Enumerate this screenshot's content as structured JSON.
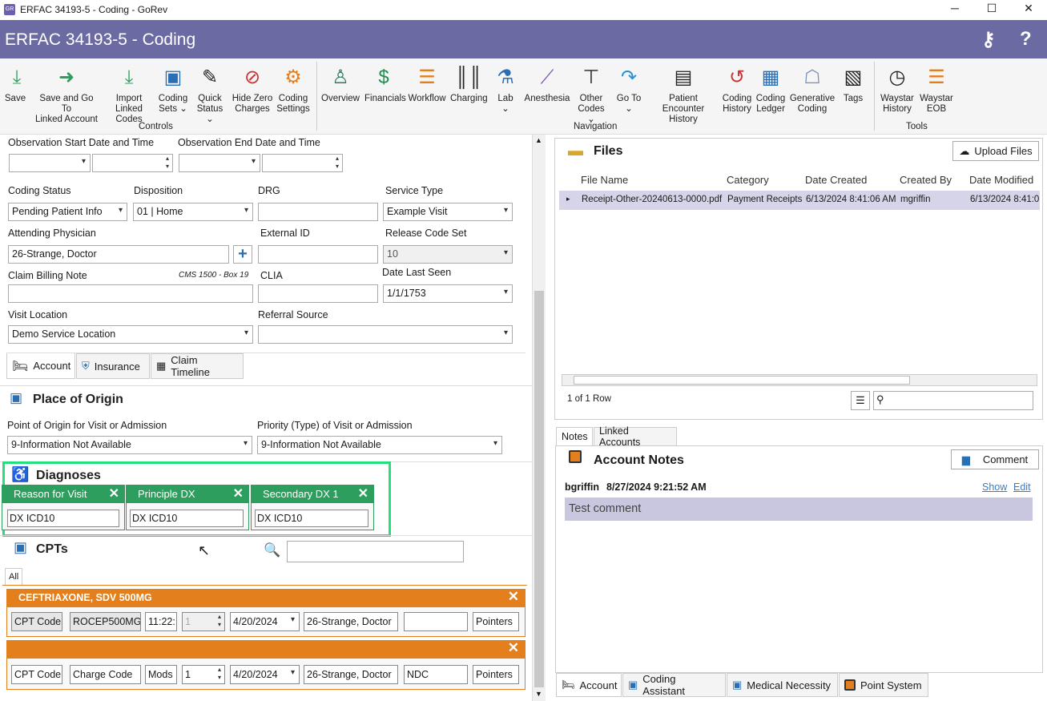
{
  "window": {
    "title": "ERFAC 34193-5 - Coding - GoRev",
    "app_icon": "GR"
  },
  "header": {
    "title": "ERFAC 34193-5 - Coding"
  },
  "ribbon": {
    "controls": [
      {
        "name": "save",
        "label": "Save"
      },
      {
        "name": "save-go-linked",
        "label": "Save and Go To\nLinked Account"
      },
      {
        "name": "import-linked",
        "label": "Import\nLinked Codes"
      },
      {
        "name": "coding-sets",
        "label": "Coding\nSets ⌄"
      },
      {
        "name": "quick-status",
        "label": "Quick\nStatus ⌄"
      },
      {
        "name": "hide-zero",
        "label": "Hide Zero\nCharges"
      },
      {
        "name": "coding-settings",
        "label": "Coding\nSettings"
      }
    ],
    "navigation": [
      {
        "name": "overview",
        "label": "Overview"
      },
      {
        "name": "financials",
        "label": "Financials"
      },
      {
        "name": "workflow",
        "label": "Workflow"
      },
      {
        "name": "charging",
        "label": "Charging"
      },
      {
        "name": "lab",
        "label": "Lab\n⌄"
      },
      {
        "name": "anesthesia",
        "label": "Anesthesia"
      },
      {
        "name": "other-codes",
        "label": "Other\nCodes ⌄"
      },
      {
        "name": "go-to",
        "label": "Go To\n⌄"
      },
      {
        "name": "encounter-history",
        "label": "Patient Encounter\nHistory"
      },
      {
        "name": "coding-history",
        "label": "Coding\nHistory"
      },
      {
        "name": "coding-ledger",
        "label": "Coding\nLedger"
      },
      {
        "name": "generative-coding",
        "label": "Generative\nCoding"
      },
      {
        "name": "tags",
        "label": "Tags"
      }
    ],
    "tools": [
      {
        "name": "waystar-history",
        "label": "Waystar\nHistory"
      },
      {
        "name": "waystar-eob",
        "label": "Waystar\nEOB"
      }
    ],
    "groups": {
      "controls": "Controls",
      "navigation": "Navigation",
      "tools": "Tools"
    }
  },
  "form": {
    "obs_start_label": "Observation Start Date and Time",
    "obs_end_label": "Observation End Date and Time",
    "coding_status_label": "Coding Status",
    "coding_status": "Pending Patient Info",
    "disposition_label": "Disposition",
    "disposition": "01 | Home",
    "drg_label": "DRG",
    "service_type_label": "Service Type",
    "service_type": "Example Visit",
    "attending_label": "Attending Physician",
    "attending": "26-Strange, Doctor",
    "external_id_label": "External ID",
    "release_code_label": "Release Code Set",
    "release_code": "10",
    "claim_note_label": "Claim Billing Note",
    "claim_note_hint": "CMS 1500 - Box 19",
    "clia_label": "CLIA",
    "last_seen_label": "Date Last Seen",
    "last_seen": "1/1/1753",
    "visit_location_label": "Visit Location",
    "visit_location": "Demo Service Location",
    "referral_label": "Referral Source"
  },
  "form_tabs": [
    "Account",
    "Insurance",
    "Claim Timeline"
  ],
  "origin": {
    "title": "Place of Origin",
    "point_label": "Point of Origin for Visit or Admission",
    "point": "9-Information Not Available",
    "priority_label": "Priority (Type) of Visit or Admission",
    "priority": "9-Information Not Available"
  },
  "diagnoses": {
    "title": "Diagnoses",
    "cards": [
      {
        "title": "Reason for Visit",
        "value": "DX ICD10"
      },
      {
        "title": "Principle DX",
        "value": "DX ICD10"
      },
      {
        "title": "Secondary DX 1",
        "value": "DX ICD10"
      }
    ]
  },
  "cpts": {
    "title": "CPTs",
    "filter_tab": "All",
    "items": [
      {
        "title": "CEFTRIAXONE, SDV 500MG",
        "code": "CPT Code",
        "charge": "ROCEP500MG",
        "mods": "11:22:",
        "qty": "1",
        "date": "4/20/2024",
        "provider": "26-Strange, Doctor",
        "ndc": "",
        "pointers": "Pointers"
      },
      {
        "title": "",
        "code": "CPT Code",
        "charge": "Charge Code",
        "mods": "Mods",
        "qty": "1",
        "date": "4/20/2024",
        "provider": "26-Strange, Doctor",
        "ndc": "NDC",
        "pointers": "Pointers"
      }
    ]
  },
  "files": {
    "title": "Files",
    "upload": "Upload Files",
    "columns": [
      "File Name",
      "Category",
      "Date Created",
      "Created By",
      "Date Modified"
    ],
    "rows": [
      [
        "Receipt-Other-20240613-0000.pdf",
        "Payment Receipts",
        "6/13/2024 8:41:06 AM",
        "mgriffin",
        "6/13/2024 8:41:0"
      ]
    ],
    "row_count": "1 of 1 Row"
  },
  "notes_tabs": [
    "Notes",
    "Linked Accounts"
  ],
  "notes": {
    "title": "Account Notes",
    "comment_btn": "Comment",
    "entry_user": "bgriffin",
    "entry_time": "8/27/2024 9:21:52 AM",
    "show": "Show",
    "edit": "Edit",
    "body": "Test comment"
  },
  "bottom_tabs": [
    "Account",
    "Coding Assistant",
    "Medical Necessity",
    "Point System"
  ],
  "colors": {
    "header": "#6b6aa3",
    "dx_green": "#2e9e5e",
    "cpt_orange": "#e47f1e",
    "highlight": "#22e07a"
  }
}
